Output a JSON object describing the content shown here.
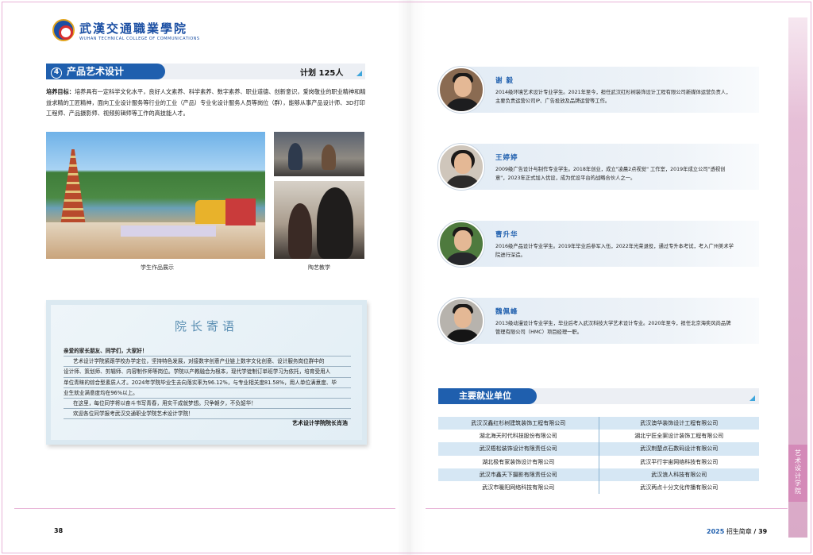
{
  "logo": {
    "cn": "武漢交通職業學院",
    "en": "WUHAN TECHNICAL COLLEGE OF COMMUNICATIONS"
  },
  "section": {
    "number": "4",
    "title": "产品艺术设计",
    "plan": "计划 125人",
    "goal_label": "培养目标：",
    "goal_text": "培养具有一定科学文化水平，良好人文素养、科学素养、数字素养、职业道德、创新意识，爱岗敬业的职业精神和精益求精的工匠精神，面向工业设计服务等行业的工业（产品）专业化设计服务人员等岗位（群），能够从事产品设计师、3D打印工程师、产品摄影师、视频剪辑师等工作的高技能人才。"
  },
  "photos": {
    "caption_left": "学生作品展示",
    "caption_right": "陶艺教学"
  },
  "dean": {
    "title": "院长寄语",
    "greeting": "亲爱的家长朋友、同学们，大家好！",
    "lines": [
      "艺术设计学院紧跟学校办学定位，坚持特色发展，对接数字创意产业链上数字文化创意、设计服务岗位群中的",
      "设计师、策划师、剪辑师、内容制作师等岗位。学院以产教融合为根本，现代学徒制订单班学习为依托，培育受用人",
      "单位青睐的综合型素质人才。2024年学院毕业生去向落实率为96.12%，与专业相关度81.58%，用人单位满意度、毕",
      "业生就业满意度均在96%以上。",
      "在这里，每位同学将以奋斗书写青春，用实干成就梦想。只争朝夕，不负韶华！",
      "欢迎各位同学报考武汉交通职业学院艺术设计学院！"
    ],
    "signature": "艺术设计学院院长肖浩"
  },
  "alumni": [
    {
      "name": "谢 毅",
      "desc": "2014级环境艺术设计专业学生。2021年至今，担任武汉红杉树装饰设计工程有限公司新媒体运营负责人，主要负责运营公司IP、广告投放及品牌运营等工作。"
    },
    {
      "name": "王婷婷",
      "desc": "2009级广告设计与制作专业学生。2018年创业，成立\"凌晨2点视觉\" 工作室，2019年成立公司\"透视创意\"，2023年正式加入优设，成为优设平台的战略合伙人之一。"
    },
    {
      "name": "曹升华",
      "desc": "2016级产品设计专业学生。2019年毕业后参军入伍，2022年光荣退役，通过专升本考试，考入广州美术学院进行深造。"
    },
    {
      "name": "魏佩峰",
      "desc": "2013级动漫设计专业学生，毕业后考入武汉科技大学艺术设计专业。2020年至今，担任北京海奕风尚品牌管理有限公司（HMC）项目经理一职。"
    }
  ],
  "employers": {
    "title": "主要就业单位",
    "rows": [
      [
        "武汉汉鑫红杉树建筑装饰工程有限公司",
        "武汉澳华装饰设计工程有限公司"
      ],
      [
        "湖北海天时代科技股份有限公司",
        "湖北宁匠全案设计装饰工程有限公司"
      ],
      [
        "武汉梧松装饰设计有限责任公司",
        "武汉荆楚点石数码设计有限公司"
      ],
      [
        "湖北极有家装饰设计有限公司",
        "武汉平行宇宙网络科技有限公司"
      ],
      [
        "武汉市鑫天下摄影有限责任公司",
        "武汉浪人科技有限公司"
      ],
      [
        "武汉市暖阳网络科技有限公司",
        "武汉两点十分文化传播有限公司"
      ]
    ]
  },
  "footer": {
    "left_page": "38",
    "year": "2025",
    "right_label": "招生简章",
    "right_page": "/ 39"
  },
  "side_tab": [
    "艺",
    "术",
    "设",
    "计",
    "学",
    "院"
  ],
  "colors": {
    "brand_blue": "#1f5fae",
    "pink": "#d48ab8",
    "light_blue": "#d6e7f4"
  }
}
